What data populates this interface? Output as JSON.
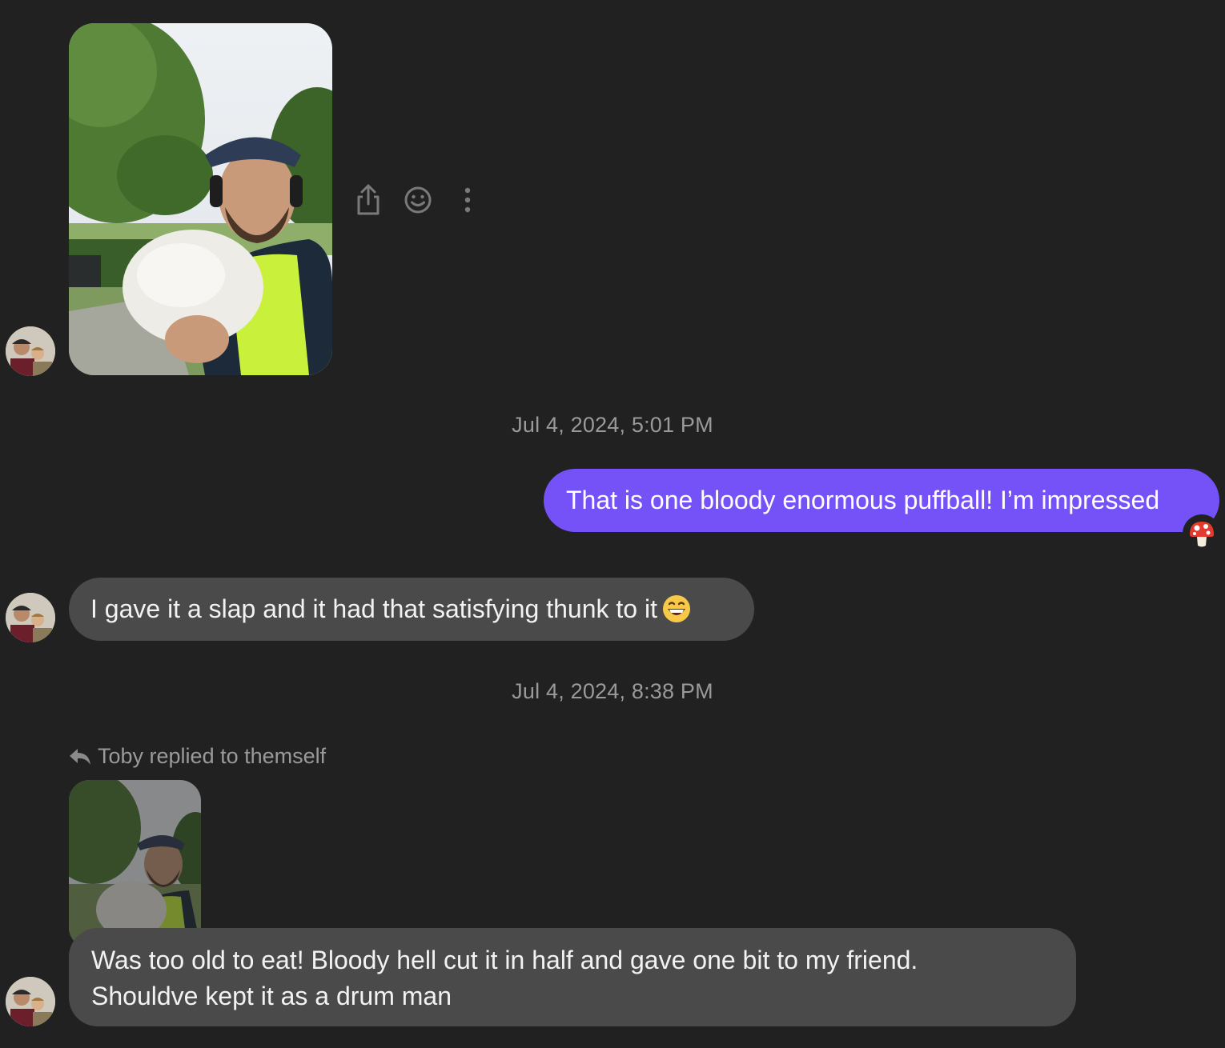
{
  "conversation": {
    "messages": [
      {
        "type": "photo",
        "direction": "incoming",
        "actions": [
          "share-icon",
          "emoji-reaction-icon",
          "more-options-icon"
        ]
      },
      {
        "type": "timestamp",
        "text": "Jul 4, 2024, 5:01 PM"
      },
      {
        "type": "text",
        "direction": "outgoing",
        "text": "That is one bloody enormous puffball! I’m impressed",
        "reaction": "mushroom-emoji"
      },
      {
        "type": "text",
        "direction": "incoming",
        "text": "I gave it a slap and it had that satisfying thunk to it",
        "trailing_emoji": "grinning-face-emoji"
      },
      {
        "type": "timestamp",
        "text": "Jul 4, 2024, 8:38 PM"
      },
      {
        "type": "reply",
        "direction": "incoming",
        "reply_header": "Toby replied to themself",
        "lines": [
          "Was too old to eat! Bloody hell cut it in half and gave one bit to my friend.",
          "Shouldve kept it as a drum man"
        ]
      }
    ]
  },
  "colors": {
    "background": "#212121",
    "outgoing_bubble": "#7552f7",
    "incoming_bubble": "#4a4a4a",
    "muted_text": "#9a9a9a"
  }
}
